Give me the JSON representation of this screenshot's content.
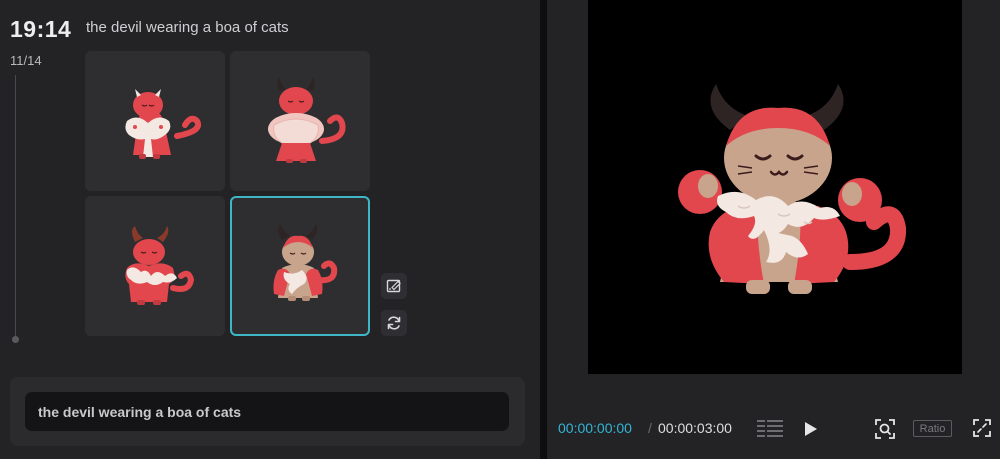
{
  "history": {
    "time": "19:14",
    "counter": "11/14",
    "prompt_title": "the devil wearing a boa of cats"
  },
  "thumbnails": [
    {
      "label": "variation 1",
      "selected": false
    },
    {
      "label": "variation 2",
      "selected": false
    },
    {
      "label": "variation 3",
      "selected": false
    },
    {
      "label": "variation 4",
      "selected": true
    }
  ],
  "side_actions": {
    "edit_icon": "edit-icon",
    "regenerate_icon": "refresh-icon"
  },
  "prompt_input": {
    "value": "the devil wearing a boa of cats"
  },
  "player": {
    "current_time": "00:00:00:00",
    "separator": "/",
    "total_time": "00:00:03:00",
    "ratio_label": "Ratio"
  },
  "colors": {
    "accent": "#3fb6c6",
    "timecode": "#33b5d4",
    "devil_red": "#e2474e",
    "cat_tan": "#c9a48c",
    "horn": "#3a2a2a"
  }
}
